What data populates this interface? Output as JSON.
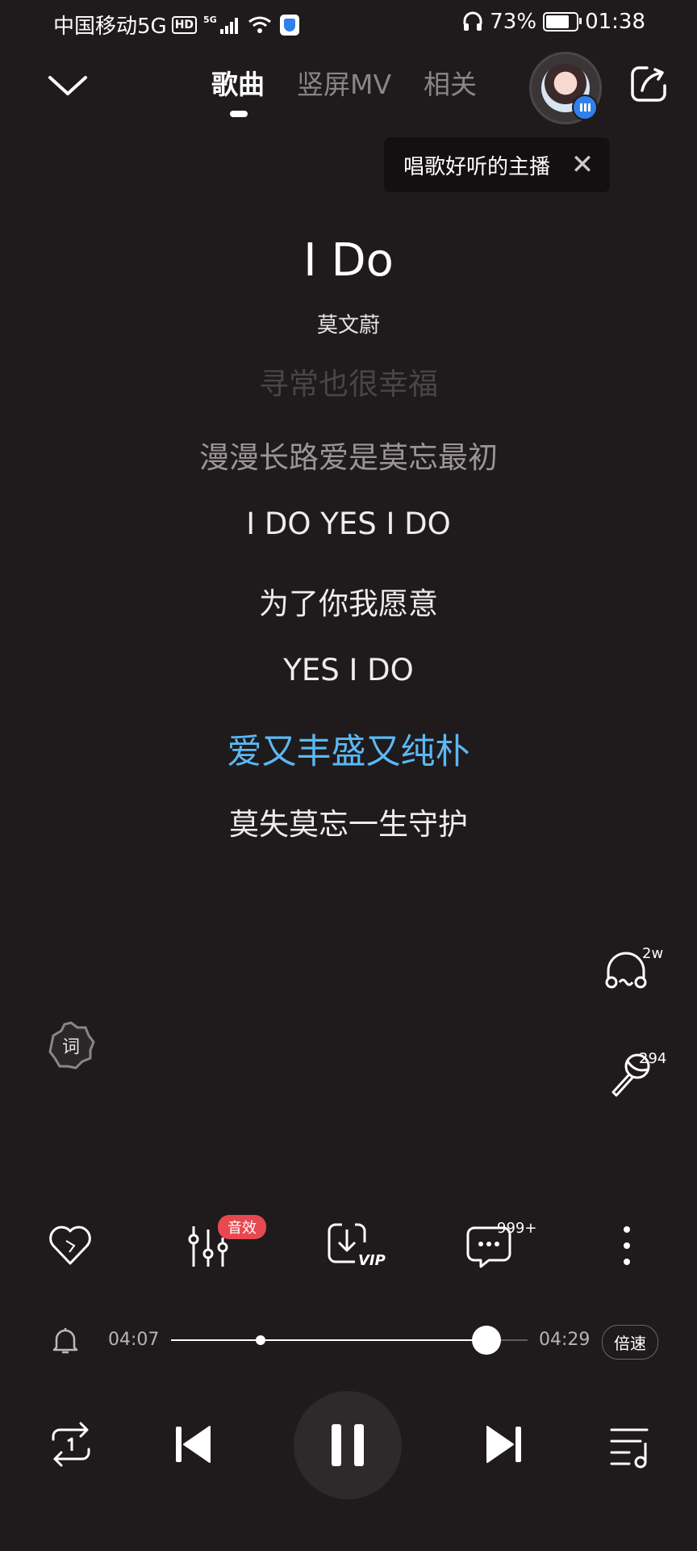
{
  "status_bar": {
    "carrier": "中国移动5G",
    "hd": "HD",
    "net": "5G",
    "battery": "73%",
    "time": "01:38"
  },
  "nav": {
    "tabs": [
      {
        "label": "歌曲",
        "active": true
      },
      {
        "label": "竖屏MV",
        "active": false
      },
      {
        "label": "相关",
        "active": false
      }
    ]
  },
  "tooltip": {
    "text": "唱歌好听的主播",
    "close": "✕"
  },
  "song": {
    "title": "I Do",
    "artist": "莫文蔚"
  },
  "lyrics": [
    {
      "text": "寻常也很幸福",
      "state": "faint"
    },
    {
      "text": "漫漫长路爱是莫忘最初",
      "state": "dim"
    },
    {
      "text": "I DO YES I DO",
      "state": "normal"
    },
    {
      "text": "为了你我愿意",
      "state": "normal"
    },
    {
      "text": "YES I DO",
      "state": "normal"
    },
    {
      "text": "爱又丰盛又纯朴",
      "state": "current"
    },
    {
      "text": "莫失莫忘一生守护",
      "state": "normal"
    }
  ],
  "side": {
    "listen_count": "2w",
    "sing_count": "294",
    "lyric_badge": "词"
  },
  "toolbar": {
    "sound_effect_badge": "音效",
    "download_vip": "VIP",
    "comment_count": "999+"
  },
  "progress": {
    "current": "04:07",
    "total": "04:29",
    "played_fraction": 0.885,
    "marker_fraction": 0.25,
    "speed_label": "倍速"
  },
  "colors": {
    "background": "#1f1a1b",
    "accent_lyric": "#5bb8f4",
    "badge_red": "#e8484f"
  }
}
